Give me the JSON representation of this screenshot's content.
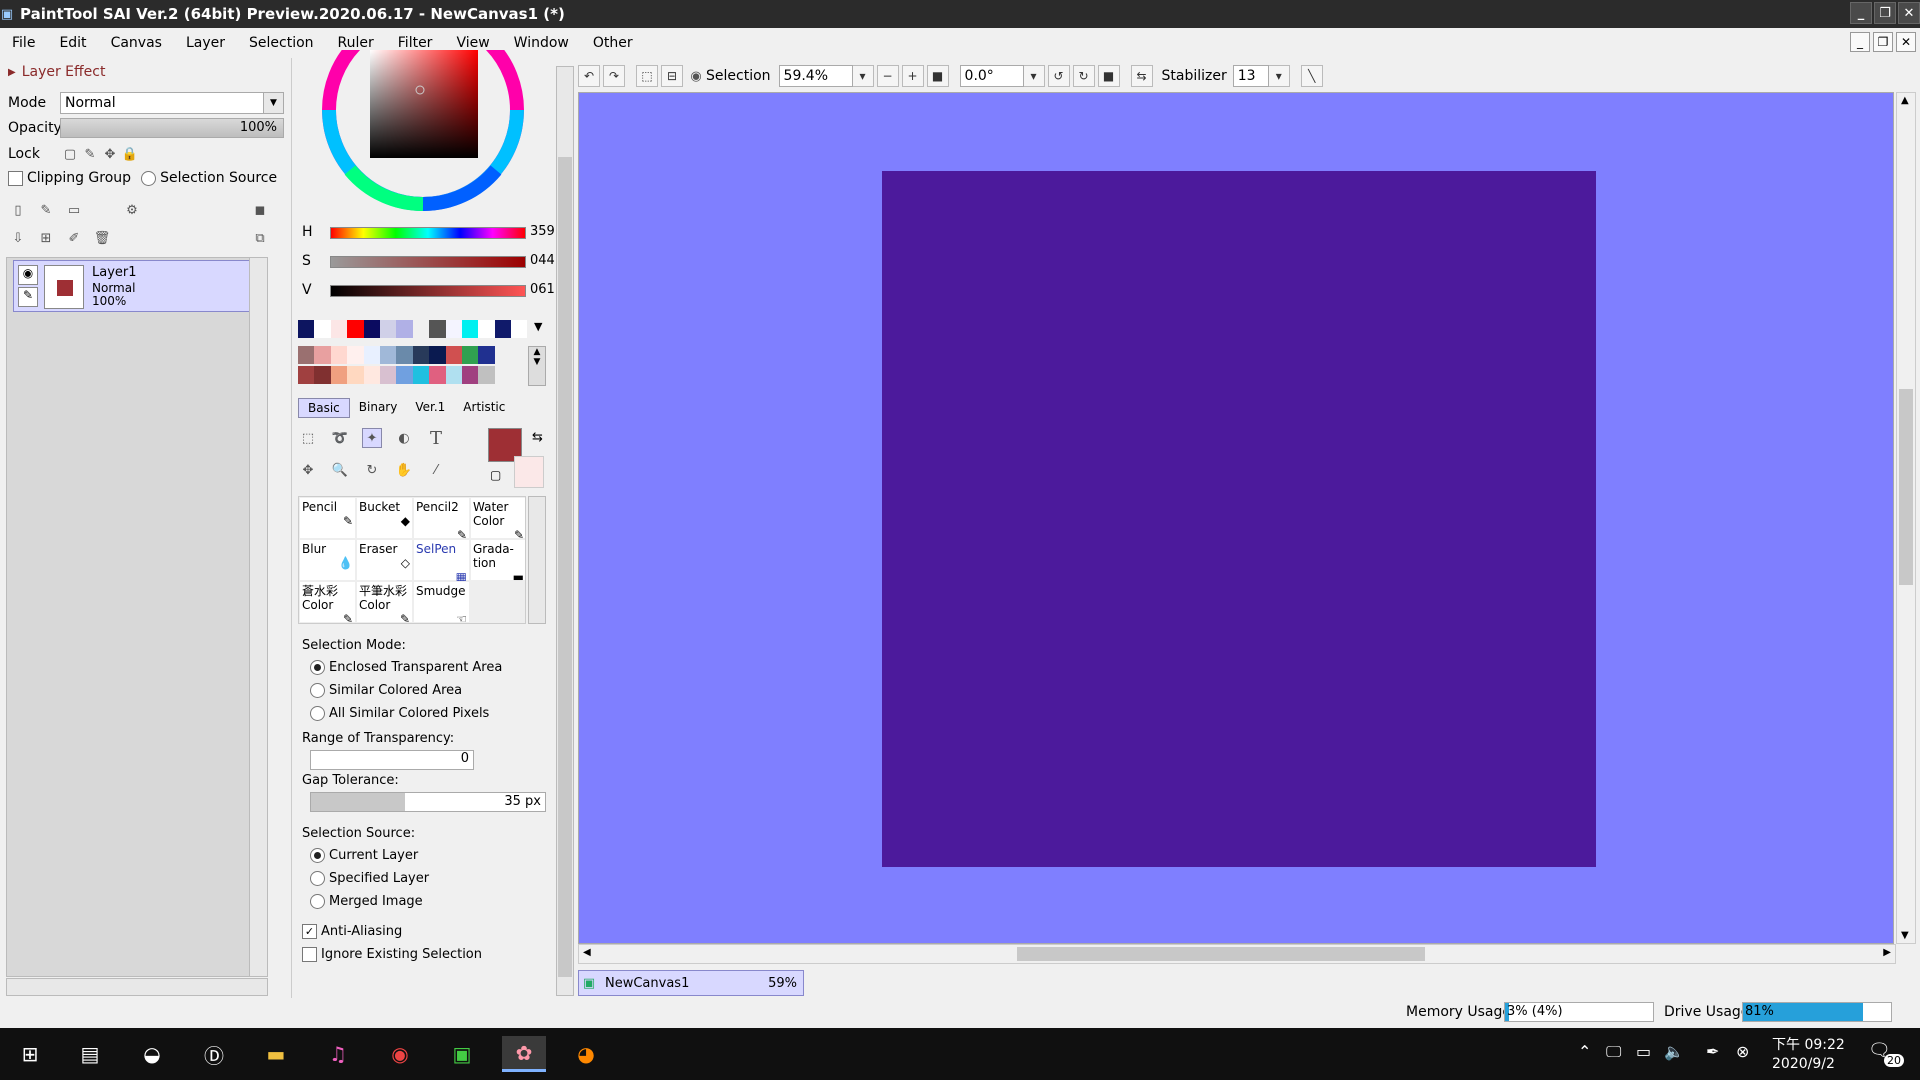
{
  "titlebar": {
    "title": "PaintTool SAI Ver.2 (64bit) Preview.2020.06.17 - NewCanvas1 (*)",
    "min": "_",
    "restore": "❐",
    "close": "✕"
  },
  "menu": {
    "items": [
      "File",
      "Edit",
      "Canvas",
      "Layer",
      "Selection",
      "Ruler",
      "Filter",
      "View",
      "Window",
      "Other"
    ],
    "mdi_min": "_",
    "mdi_restore": "❐",
    "mdi_close": "✕"
  },
  "layer_effect": {
    "label": "Layer Effect"
  },
  "mode": {
    "label": "Mode",
    "value": "Normal"
  },
  "opacity": {
    "label": "Opacity",
    "value": "100%"
  },
  "lock": {
    "label": "Lock"
  },
  "clipping_group": {
    "label": "Clipping Group"
  },
  "selection_source_toggle": {
    "label": "Selection Source"
  },
  "layer": {
    "name": "Layer1",
    "mode": "Normal",
    "opacity": "100%",
    "color": "#9e2f34"
  },
  "color": {
    "h": {
      "label": "H",
      "value": "359"
    },
    "s": {
      "label": "S",
      "value": "044"
    },
    "v": {
      "label": "V",
      "value": "061"
    },
    "foreground": "#9e2f34",
    "background": "#fbe8e8"
  },
  "swatches_row1": [
    "#0d1560",
    "#ffffff",
    "#fce6e6",
    "#ff0000",
    "#0b0b60",
    "#d0d0e8",
    "#b0b0e6",
    "#f0f0f0",
    "#555555",
    "#f4f4ff",
    "#00f0f0",
    "#ffffff",
    "#101a6a",
    "#ffffff"
  ],
  "swatches_row2": [
    "#9a7070",
    "#e8a0a0",
    "#ffd8d0",
    "#fff0ee",
    "#e8f0ff",
    "#a0b8d8",
    "#6a8aaa",
    "#283a5a",
    "#0a1a50",
    "#d05050",
    "#30a050",
    "#203090"
  ],
  "swatches_row3": [
    "#a04040",
    "#803030",
    "#f0a080",
    "#ffd8c0",
    "#ffe8e0",
    "#d8c0d0",
    "#70a0e0",
    "#20c0e0",
    "#e06080",
    "#b0e0f0",
    "#a04080",
    "#c0c0c0"
  ],
  "brush_tabs": [
    "Basic",
    "Binary",
    "Ver.1",
    "Artistic"
  ],
  "tools": [
    {
      "name": "Pencil",
      "icon": "✎"
    },
    {
      "name": "Bucket",
      "icon": "◆"
    },
    {
      "name": "Pencil2",
      "icon": "✎"
    },
    {
      "name": "Water Color",
      "icon": "✎"
    },
    {
      "name": "Blur",
      "icon": "💧"
    },
    {
      "name": "Eraser",
      "icon": "◇"
    },
    {
      "name": "SelPen",
      "icon": "▦"
    },
    {
      "name": "Grada-tion",
      "icon": "▬"
    },
    {
      "name": "蒼水彩 Color",
      "icon": "✎"
    },
    {
      "name": "平筆水彩 Color",
      "icon": "✎"
    },
    {
      "name": "Smudge",
      "icon": "☜"
    },
    {
      "name": "",
      "icon": ""
    }
  ],
  "selection_mode": {
    "label": "Selection Mode:",
    "options": [
      "Enclosed Transparent Area",
      "Similar Colored Area",
      "All Similar Colored Pixels"
    ],
    "selected": 0
  },
  "range_transparency": {
    "label": "Range of Transparency:",
    "value": "0"
  },
  "gap_tolerance": {
    "label": "Gap Tolerance:",
    "value": "35 px",
    "fraction": 0.4
  },
  "selection_source": {
    "label": "Selection Source:",
    "options": [
      "Current Layer",
      "Specified Layer",
      "Merged Image"
    ],
    "selected": 0
  },
  "anti_aliasing": {
    "label": "Anti-Aliasing",
    "checked": true,
    "mark": "✓"
  },
  "ignore_selection": {
    "label": "Ignore Existing Selection"
  },
  "toolbar": {
    "selection_label": "Selection",
    "zoom": "59.4%",
    "angle": "0.0°",
    "stabilizer_label": "Stabilizer",
    "stabilizer_value": "13"
  },
  "canvas": {
    "bg": "#7f7fff",
    "fill": "#4c1a9c"
  },
  "doc_tab": {
    "name": "NewCanvas1",
    "zoom": "59%"
  },
  "status": {
    "memory_label": "Memory Usage",
    "memory_value": "3% (4%)",
    "memory_fraction": 0.03,
    "drive_label": "Drive Usage",
    "drive_value": "81%",
    "drive_fraction": 0.81
  },
  "taskbar": {
    "time": "下午 09:22",
    "date": "2020/9/2",
    "notifications": "20"
  }
}
